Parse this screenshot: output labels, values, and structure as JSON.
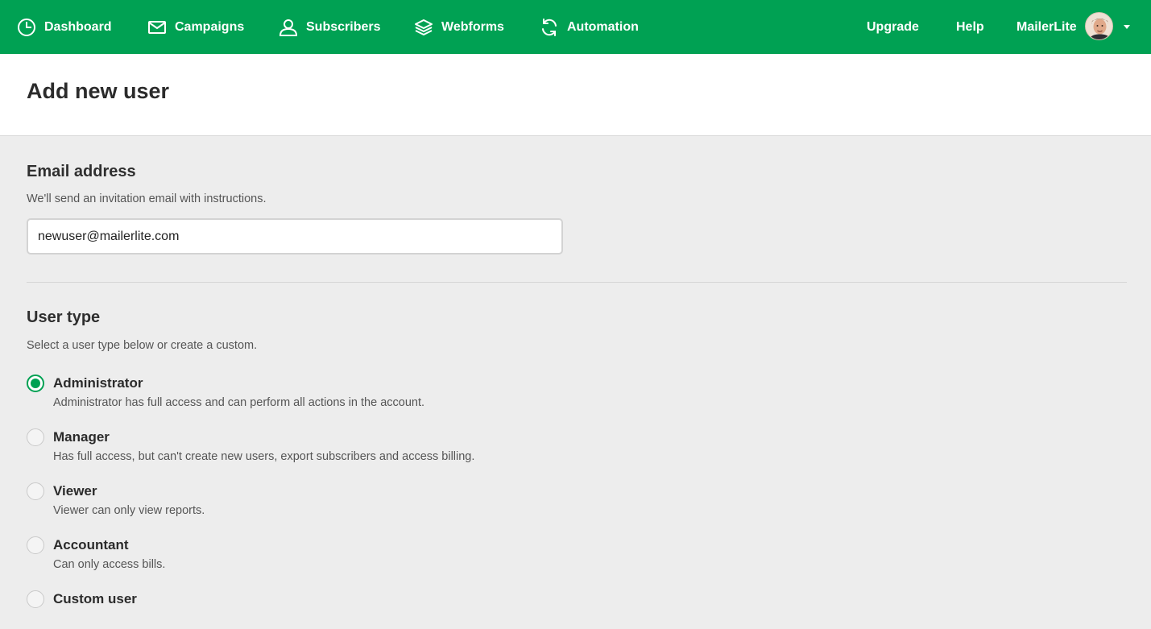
{
  "nav": {
    "items": [
      {
        "label": "Dashboard",
        "icon": "clock-icon"
      },
      {
        "label": "Campaigns",
        "icon": "envelope-icon"
      },
      {
        "label": "Subscribers",
        "icon": "user-icon"
      },
      {
        "label": "Webforms",
        "icon": "layers-icon"
      },
      {
        "label": "Automation",
        "icon": "refresh-icon"
      }
    ],
    "upgrade": "Upgrade",
    "help": "Help",
    "account": "MailerLite"
  },
  "page": {
    "title": "Add new user"
  },
  "email_section": {
    "title": "Email address",
    "description": "We'll send an invitation email with instructions.",
    "input_value": "newuser@mailerlite.com"
  },
  "user_type_section": {
    "title": "User type",
    "description": "Select a user type below or create a custom.",
    "options": [
      {
        "label": "Administrator",
        "description": "Administrator has full access and can perform all actions in the account.",
        "selected": true
      },
      {
        "label": "Manager",
        "description": "Has full access, but can't create new users, export subscribers and access billing.",
        "selected": false
      },
      {
        "label": "Viewer",
        "description": "Viewer can only view reports.",
        "selected": false
      },
      {
        "label": "Accountant",
        "description": "Can only access bills.",
        "selected": false
      },
      {
        "label": "Custom user",
        "description": "",
        "selected": false
      }
    ]
  },
  "colors": {
    "brand_green": "#00a153",
    "page_background": "#ededed"
  }
}
